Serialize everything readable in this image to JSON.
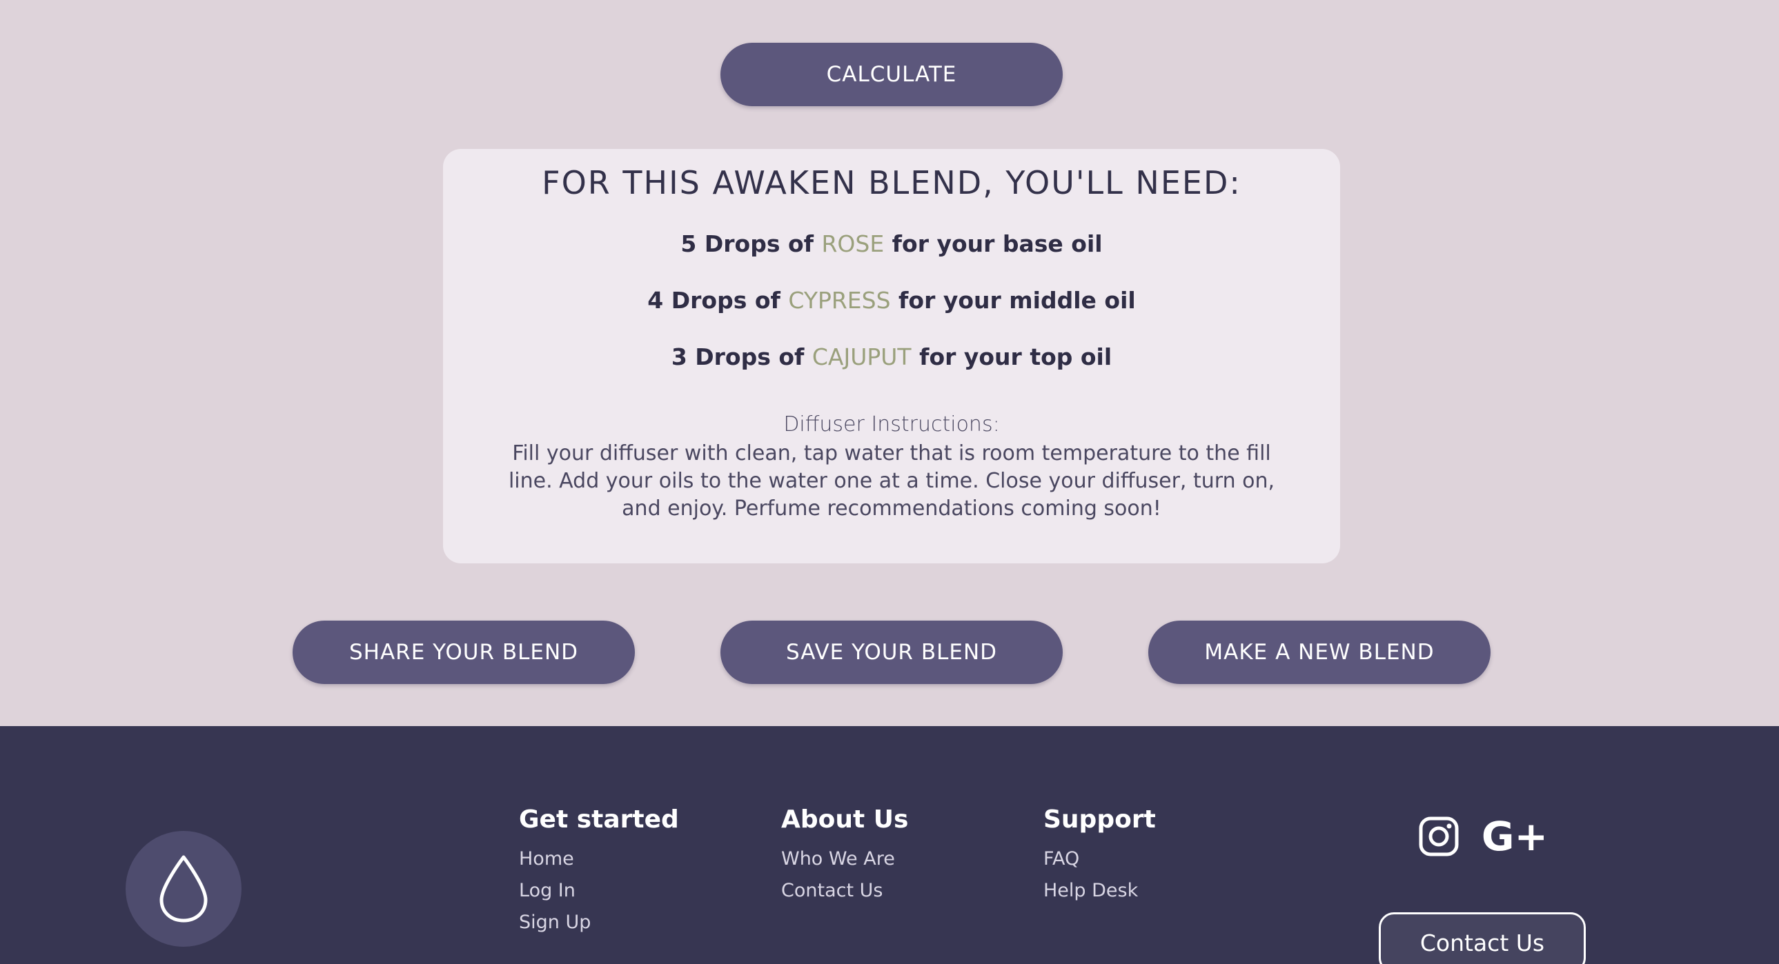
{
  "actions": {
    "calculate_label": "CALCULATE",
    "share_label": "SHARE YOUR BLEND",
    "save_label": "SAVE YOUR BLEND",
    "new_label": "MAKE A NEW BLEND"
  },
  "result": {
    "title": "FOR THIS AWAKEN BLEND, YOU'LL NEED:",
    "oils": [
      {
        "prefix": "5 Drops of ",
        "name": "ROSE",
        "suffix": " for your base oil"
      },
      {
        "prefix": "4 Drops of ",
        "name": "CYPRESS",
        "suffix": " for your middle oil"
      },
      {
        "prefix": "3 Drops of ",
        "name": "CAJUPUT",
        "suffix": " for your top oil"
      }
    ],
    "instructions_heading": "Diffuser Instructions:",
    "instructions_body": "Fill your diffuser with clean, tap water that is room temperature to the fill line. Add your oils to the water one at a time. Close your diffuser, turn on, and enjoy. Perfume recommendations coming soon!"
  },
  "footer": {
    "logo_icon": "droplet-icon",
    "columns": [
      {
        "heading": "Get started",
        "links": [
          "Home",
          "Log In",
          "Sign Up"
        ]
      },
      {
        "heading": "About Us",
        "links": [
          "Who We Are",
          "Contact Us"
        ]
      },
      {
        "heading": "Support",
        "links": [
          "FAQ",
          "Help Desk"
        ]
      }
    ],
    "social": {
      "instagram_icon": "instagram-icon",
      "googleplus_label": "G+"
    },
    "contact_label": "Contact Us"
  },
  "colors": {
    "background": "#ded3da",
    "button": "#5c577c",
    "card": "#efe9ef",
    "oil_accent": "#9aa07c",
    "footer": "#373652"
  }
}
